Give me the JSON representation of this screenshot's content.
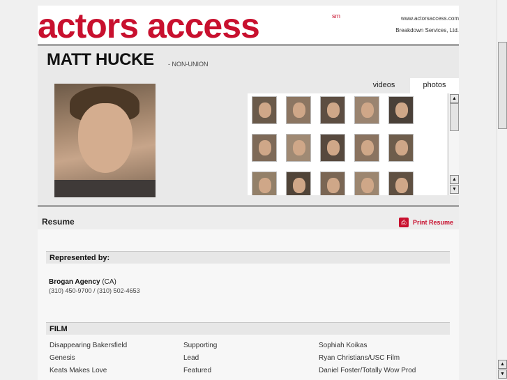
{
  "header": {
    "logo_text": "actors access",
    "logo_sm": "sm",
    "site_url": "www.actorsaccess.com",
    "company": "Breakdown Services, Ltd.",
    "brand_color": "#c8102e"
  },
  "profile": {
    "name": "MATT HUCKE",
    "union_status": "- NON-UNION"
  },
  "media_tabs": {
    "videos_label": "videos",
    "photos_label": "photos",
    "active": "photos"
  },
  "gallery": {
    "thumb_rows": 3,
    "thumbs_per_row": 5
  },
  "resume": {
    "title": "Resume",
    "print_label": "Print Resume",
    "print_icon": "print-icon"
  },
  "representation": {
    "heading": "Represented by:",
    "agency": "Brogan Agency",
    "region": "(CA)",
    "phones": "(310) 450-9700 / (310) 502-4653"
  },
  "film": {
    "heading": "FILM",
    "rows": [
      {
        "title": "Disappearing Bakersfield",
        "role": "Supporting",
        "company": "Sophiah Koikas"
      },
      {
        "title": "Genesis",
        "role": "Lead",
        "company": "Ryan Christians/USC Film"
      },
      {
        "title": "Keats Makes Love",
        "role": "Featured",
        "company": "Daniel Foster/Totally Wow Prod"
      }
    ]
  },
  "scrollbars": {
    "gallery_up_icon": "arrow-up-icon",
    "gallery_down_icon": "arrow-down-icon",
    "window_up_icon": "arrow-up-icon",
    "window_down_icon": "arrow-down-icon"
  }
}
